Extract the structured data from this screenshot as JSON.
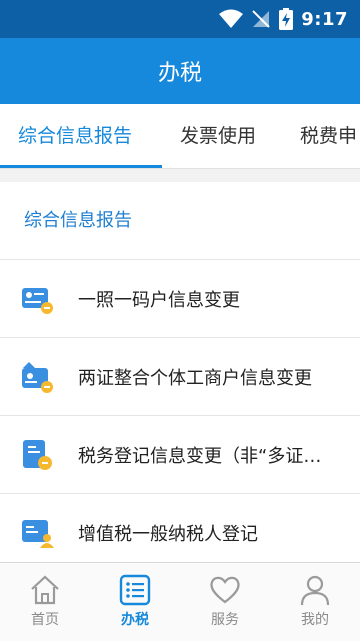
{
  "status_bar": {
    "time": "9:17"
  },
  "app_bar": {
    "title": "办税"
  },
  "tabs": [
    {
      "label": "综合信息报告",
      "active": true
    },
    {
      "label": "发票使用",
      "active": false
    },
    {
      "label": "税费申",
      "active": false
    }
  ],
  "section": {
    "title": "综合信息报告"
  },
  "items": [
    {
      "label": "一照一码户信息变更",
      "icon": "id-card-edit-icon"
    },
    {
      "label": "两证整合个体工商户信息变更",
      "icon": "business-license-edit-icon"
    },
    {
      "label": "税务登记信息变更（非“多证…",
      "icon": "tax-registration-edit-icon"
    },
    {
      "label": "增值税一般纳税人登记",
      "icon": "fill-form-user-icon"
    }
  ],
  "bottom_nav": [
    {
      "label": "首页",
      "icon": "home-icon",
      "active": false
    },
    {
      "label": "办税",
      "icon": "list-icon",
      "active": true
    },
    {
      "label": "服务",
      "icon": "heart-icon",
      "active": false
    },
    {
      "label": "我的",
      "icon": "person-icon",
      "active": false
    }
  ],
  "colors": {
    "status_bar": "#0d5fa6",
    "app_bar": "#1689dc",
    "accent": "#1689dc",
    "icon_badge": "#f5b82e"
  }
}
